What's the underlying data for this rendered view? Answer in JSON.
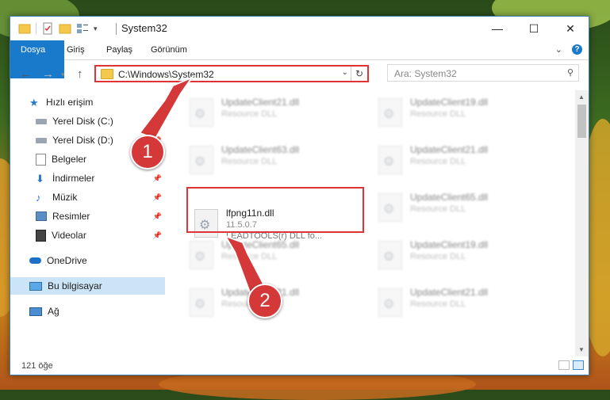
{
  "window": {
    "title": "System32",
    "controls": {
      "minimize": "—",
      "maximize": "☐",
      "close": "✕"
    }
  },
  "ribbon": {
    "tabs": [
      "Dosya",
      "Giriş",
      "Paylaş",
      "Görünüm"
    ]
  },
  "addressbar": {
    "path": "C:\\Windows\\System32",
    "search_placeholder": "Ara: System32"
  },
  "sidebar": {
    "items": [
      {
        "label": "Hızlı erişim",
        "icon": "star-icon"
      },
      {
        "label": "Yerel Disk (C:)",
        "icon": "drive-icon"
      },
      {
        "label": "Yerel Disk (D:)",
        "icon": "drive-icon"
      },
      {
        "label": "Belgeler",
        "icon": "documents-icon"
      },
      {
        "label": "İndirmeler",
        "icon": "download-icon"
      },
      {
        "label": "Müzik",
        "icon": "music-icon"
      },
      {
        "label": "Resimler",
        "icon": "pictures-icon"
      },
      {
        "label": "Videolar",
        "icon": "videos-icon"
      },
      {
        "label": "OneDrive",
        "icon": "cloud-icon"
      },
      {
        "label": "Bu bilgisayar",
        "icon": "computer-icon"
      },
      {
        "label": "Ağ",
        "icon": "network-icon"
      }
    ]
  },
  "files": {
    "f1": {
      "name": "UpdateClient21.dll",
      "desc": "Resource DLL"
    },
    "f2": {
      "name": "UpdateClient19.dll",
      "desc": "Resource DLL"
    },
    "f3": {
      "name": "UpdateClient63.dll",
      "desc": "Resource DLL"
    },
    "f4": {
      "name": "UpdateClient21.dll",
      "desc": "Resource DLL"
    },
    "f5": {
      "name": "lfpng11n.dll",
      "desc": "11.5.0.7",
      "desc2": "LEADTOOLS(r) DLL fo..."
    },
    "f6": {
      "name": "UpdateClient65.dll",
      "desc": "Resource DLL"
    },
    "f7": {
      "name": "UpdateClient65.dll",
      "desc": "Resource DLL"
    },
    "f8": {
      "name": "UpdateClient19.dll",
      "desc": "Resource DLL"
    },
    "f9": {
      "name": "UpdateClient21.dll",
      "desc": "Resource DLL"
    },
    "f10": {
      "name": "UpdateClient21.dll",
      "desc": "Resource DLL"
    }
  },
  "status": {
    "count": "121 öğe"
  },
  "callouts": {
    "one": "1",
    "two": "2"
  },
  "colors": {
    "accent": "#1979ca",
    "highlight": "#e03434",
    "selected": "#cce4f7"
  }
}
